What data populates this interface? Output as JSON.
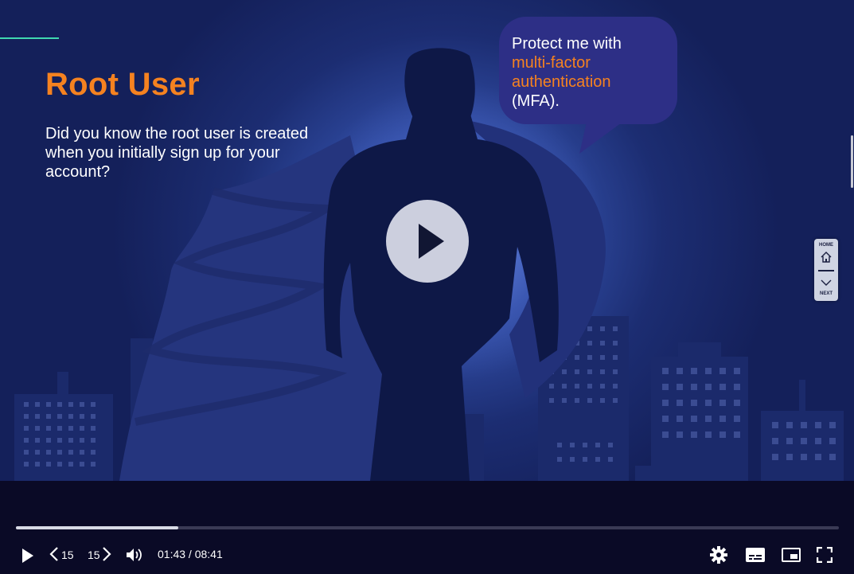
{
  "slide": {
    "title": "Root User",
    "body": "Did you know the root user is created when you initially sign up for your account?",
    "bubble": {
      "line1": "Protect me with",
      "highlight_line1": "multi-factor",
      "highlight_line2": "authentication",
      "line_end": "(MFA)."
    }
  },
  "side_nav": {
    "home_label": "HOME",
    "next_label": "NEXT",
    "home_icon": "home-icon",
    "next_icon": "chevron-down-icon"
  },
  "player": {
    "current_time": "01:43",
    "duration": "08:41",
    "time_display": "01:43 / 08:41",
    "progress": 0.197,
    "rewind_seconds": "15",
    "forward_seconds": "15",
    "icons": [
      "play-icon",
      "rewind-15-icon",
      "forward-15-icon",
      "volume-icon",
      "settings-icon",
      "captions-icon",
      "picture-in-picture-icon",
      "fullscreen-icon"
    ]
  },
  "colors": {
    "accent_orange": "#f58220",
    "bubble_bg": "#2d2f86",
    "progress_teal": "#3fd8b0",
    "controls_bg": "#0a0a26"
  }
}
